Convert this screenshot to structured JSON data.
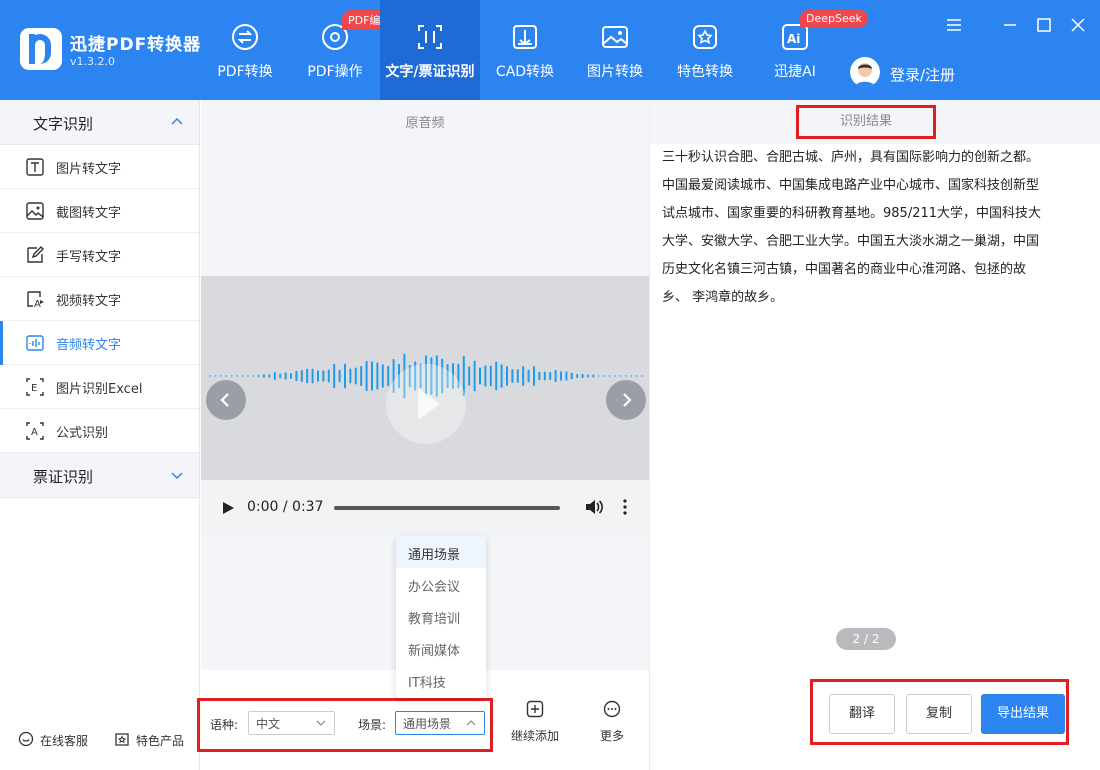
{
  "app": {
    "name": "迅捷PDF转换器",
    "version": "v1.3.2.0"
  },
  "nav": [
    {
      "label": "PDF转换",
      "badge": ""
    },
    {
      "label": "PDF操作",
      "badge": "PDF编辑"
    },
    {
      "label": "文字/票证识别",
      "badge": "",
      "active": true
    },
    {
      "label": "CAD转换",
      "badge": ""
    },
    {
      "label": "图片转换",
      "badge": ""
    },
    {
      "label": "特色转换",
      "badge": ""
    },
    {
      "label": "迅捷AI",
      "badge": "DeepSeek"
    }
  ],
  "user": {
    "login_label": "登录/注册"
  },
  "sidebar": {
    "section1": "文字识别",
    "items": [
      {
        "label": "图片转文字",
        "icon": "text-t-icon"
      },
      {
        "label": "截图转文字",
        "icon": "screenshot-icon"
      },
      {
        "label": "手写转文字",
        "icon": "handwrite-icon"
      },
      {
        "label": "视频转文字",
        "icon": "video-text-icon"
      },
      {
        "label": "音频转文字",
        "icon": "audio-text-icon",
        "active": true
      },
      {
        "label": "图片识别Excel",
        "icon": "excel-icon"
      },
      {
        "label": "公式识别",
        "icon": "formula-icon"
      }
    ],
    "section2": "票证识别",
    "footer": {
      "service": "在线客服",
      "products": "特色产品"
    }
  },
  "audio": {
    "title": "原音频",
    "time": "0:00 / 0:37"
  },
  "scene_dropdown": {
    "options": [
      "通用场景",
      "办公会议",
      "教育培训",
      "新闻媒体",
      "IT科技"
    ]
  },
  "toolbar": {
    "lang_label": "语种:",
    "lang_value": "中文",
    "scene_label": "场景:",
    "scene_value": "通用场景",
    "add_label": "继续添加",
    "more_label": "更多"
  },
  "result": {
    "title": "识别结果",
    "lines": [
      "三十秒认识合肥、合肥古城、庐州，具有国际影响力的创新之都。",
      "中国最爱阅读城市、中国集成电路产业中心城市、国家科技创新型",
      "试点城市、国家重要的科研教育基地。985/211大学，中国科技大",
      "大学、安徽大学、合肥工业大学。中国五大淡水湖之一巢湖，中国",
      "历史文化名镇三河古镇，中国著名的商业中心淮河路、包拯的故",
      "乡、 李鸿章的故乡。"
    ],
    "page": "2 / 2",
    "translate": "翻译",
    "copy": "复制",
    "export": "导出结果"
  }
}
